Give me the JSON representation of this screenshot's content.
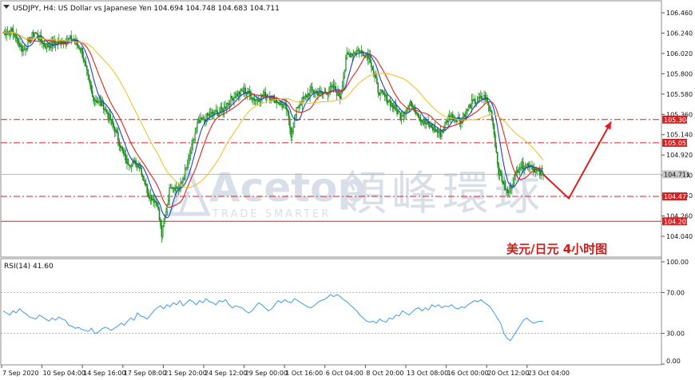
{
  "header": {
    "symbol_line": "USDJPY, H4:  US Dollar vs Japanese Yen  104.694 104.748 104.683 104.711"
  },
  "annotation": {
    "cn_title": "美元/日元   4小时图",
    "watermark_brand": "Acetop",
    "watermark_cn": "領峰環球",
    "watermark_tag": "TRADE SMARTER"
  },
  "colors": {
    "bull_candle": "#1a8a1a",
    "bear_candle": "#1a8a1a",
    "ma_fast": "#1d3fd6",
    "ma_mid": "#e0231f",
    "ma_slow": "#f2c230",
    "level_line": "#d62222",
    "rsi_line": "#3d9ee0",
    "arrow": "#e01b1b",
    "tag_bg": "#d62222",
    "current_bg": "#c8c8c8"
  },
  "chart_data": [
    {
      "type": "candlestick",
      "title": "USDJPY, H4",
      "ylim": [
        104.0,
        106.5
      ],
      "price_ticks": [
        "106.460",
        "106.240",
        "106.020",
        "105.800",
        "105.580",
        "105.360",
        "105.140",
        "104.920",
        "104.700",
        "104.480",
        "104.260",
        "104.040"
      ],
      "levels": [
        {
          "value": 105.304,
          "label": "105.304",
          "style": "dash-dot"
        },
        {
          "value": 105.052,
          "label": "105.052",
          "style": "dash-dot"
        },
        {
          "value": 104.472,
          "label": "104.472",
          "style": "dash-dot"
        },
        {
          "value": 104.202,
          "label": "104.202",
          "style": "solid"
        }
      ],
      "current_price": {
        "value": 104.711,
        "label": "104.711"
      },
      "time_labels": [
        "7 Sep 2020",
        "10 Sep 04:00",
        "14 Sep 16:00",
        "17 Sep 08:00",
        "21 Sep 20:00",
        "24 Sep 12:00",
        "29 Sep 00:00",
        "1 Oct 16:00",
        "6 Oct 04:00",
        "8 Oct 20:00",
        "13 Oct 08:00",
        "16 Oct 00:00",
        "20 Oct 12:00",
        "23 Oct 04:00"
      ],
      "path_anchors": [
        [
          0,
          106.25
        ],
        [
          8,
          106.26
        ],
        [
          18,
          106.05
        ],
        [
          28,
          106.25
        ],
        [
          38,
          106.1
        ],
        [
          52,
          106.15
        ],
        [
          62,
          106.18
        ],
        [
          70,
          106.06
        ],
        [
          80,
          105.55
        ],
        [
          90,
          105.45
        ],
        [
          100,
          105.2
        ],
        [
          110,
          104.85
        ],
        [
          122,
          104.82
        ],
        [
          130,
          104.5
        ],
        [
          138,
          104.4
        ],
        [
          142,
          104.05
        ],
        [
          150,
          104.6
        ],
        [
          158,
          104.55
        ],
        [
          166,
          104.85
        ],
        [
          174,
          105.25
        ],
        [
          184,
          105.35
        ],
        [
          196,
          105.4
        ],
        [
          206,
          105.55
        ],
        [
          216,
          105.62
        ],
        [
          226,
          105.52
        ],
        [
          236,
          105.58
        ],
        [
          246,
          105.5
        ],
        [
          254,
          105.42
        ],
        [
          258,
          105.15
        ],
        [
          264,
          105.45
        ],
        [
          276,
          105.62
        ],
        [
          286,
          105.58
        ],
        [
          296,
          105.65
        ],
        [
          302,
          105.55
        ],
        [
          308,
          106.0
        ],
        [
          318,
          106.05
        ],
        [
          328,
          106.0
        ],
        [
          336,
          105.62
        ],
        [
          346,
          105.5
        ],
        [
          356,
          105.35
        ],
        [
          366,
          105.48
        ],
        [
          376,
          105.28
        ],
        [
          384,
          105.22
        ],
        [
          392,
          105.15
        ],
        [
          400,
          105.35
        ],
        [
          410,
          105.3
        ],
        [
          420,
          105.48
        ],
        [
          432,
          105.55
        ],
        [
          438,
          105.35
        ],
        [
          444,
          104.75
        ],
        [
          452,
          104.5
        ],
        [
          462,
          104.8
        ],
        [
          472,
          104.82
        ],
        [
          480,
          104.72
        ],
        [
          484,
          104.71
        ]
      ],
      "moving_averages": [
        {
          "role": "fast",
          "period": 10
        },
        {
          "role": "mid",
          "period": 21
        },
        {
          "role": "slow",
          "period": 55
        }
      ],
      "projection_arrow": [
        [
          104.711,
          0
        ],
        [
          104.45,
          1
        ],
        [
          105.28,
          2
        ]
      ]
    },
    {
      "type": "line",
      "title": "RSI(14) 41.60",
      "ylim": [
        0,
        100
      ],
      "ticks": [
        "100.00",
        "70.00",
        "30.00",
        "0.00"
      ],
      "levels": [
        70,
        30
      ],
      "series": [
        {
          "name": "RSI(14)",
          "values": [
            52,
            50,
            48,
            52,
            50,
            54,
            51,
            49,
            46,
            45,
            44,
            48,
            46,
            44,
            42,
            45,
            43,
            46,
            44,
            43,
            38,
            37,
            35,
            36,
            34,
            33,
            32,
            35,
            30,
            31,
            34,
            36,
            35,
            33,
            35,
            37,
            40,
            38,
            42,
            45,
            43,
            50,
            47,
            46,
            44,
            48,
            52,
            55,
            57,
            54,
            58,
            56,
            60,
            58,
            62,
            57,
            60,
            63,
            61,
            58,
            62,
            60,
            64,
            61,
            60,
            58,
            62,
            61,
            63,
            58,
            55,
            57,
            56,
            55,
            52,
            50,
            52,
            56,
            60,
            58,
            55,
            52,
            54,
            58,
            62,
            60,
            63,
            61,
            60,
            64,
            62,
            60,
            58,
            56,
            55,
            57,
            60,
            62,
            63,
            65,
            68,
            66,
            68,
            66,
            63,
            61,
            58,
            55,
            52,
            48,
            45,
            42,
            41,
            42,
            40,
            44,
            42,
            41,
            45,
            44,
            48,
            47,
            52,
            50,
            48,
            51,
            54,
            55,
            52,
            55,
            53,
            58,
            56,
            58,
            55,
            57,
            56,
            58,
            55,
            54,
            56,
            55,
            58,
            60,
            62,
            61,
            63,
            60,
            58,
            55,
            50,
            45,
            40,
            30,
            25,
            23,
            28,
            33,
            38,
            43,
            45,
            42,
            40,
            41,
            42,
            41.6
          ]
        }
      ]
    }
  ]
}
